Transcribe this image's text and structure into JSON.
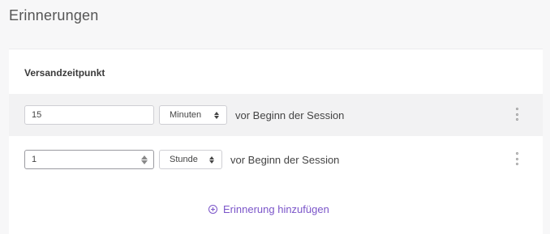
{
  "page": {
    "title": "Erinnerungen"
  },
  "section": {
    "label": "Versandzeitpunkt"
  },
  "reminders": [
    {
      "value": "15",
      "unit": "Minuten",
      "suffix": "vor Beginn der Session"
    },
    {
      "value": "1",
      "unit": "Stunde",
      "suffix": "vor Beginn der Session"
    }
  ],
  "actions": {
    "add_label": "Erinnerung hinzufügen"
  },
  "colors": {
    "accent": "#7b55c9",
    "row_highlight": "#f2f2f3"
  },
  "icons": {
    "stepper": "number-stepper-icon",
    "select": "select-arrows-icon",
    "menu": "kebab-menu-icon",
    "add": "plus-circle-icon"
  }
}
